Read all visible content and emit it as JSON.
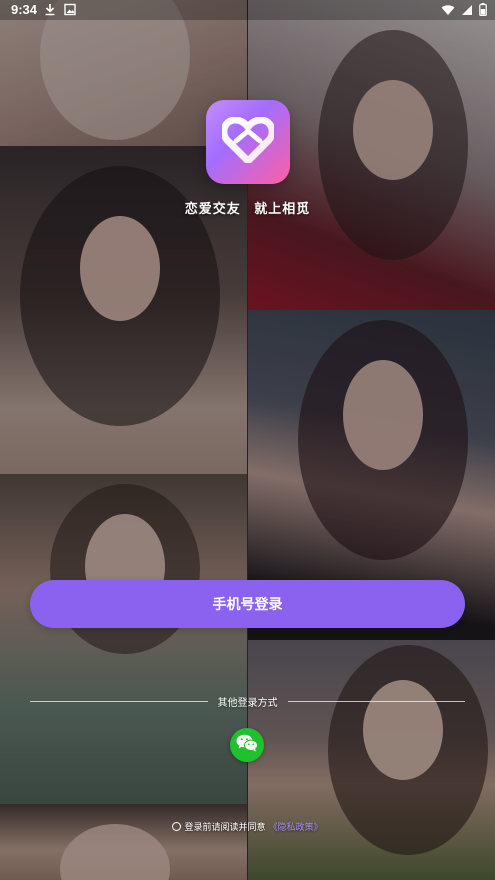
{
  "status_bar": {
    "time": "9:34",
    "left_icons": [
      "download-icon",
      "image-icon"
    ],
    "right_icons": [
      "wifi-icon",
      "signal-icon",
      "battery-icon"
    ]
  },
  "branding": {
    "slogan_part1": "恋爱交友",
    "slogan_part2": "就上相觅",
    "logo_icon": "heart-logo-icon"
  },
  "login": {
    "phone_button_label": "手机号登录",
    "other_methods_label": "其他登录方式",
    "wechat_icon": "wechat-icon"
  },
  "agreement": {
    "text": "登录前请阅读并同意",
    "privacy_link": "《隐私政策》"
  },
  "colors": {
    "primary_button": "#8b62f0",
    "wechat_green": "#1fc12f",
    "link": "#a98bff"
  }
}
